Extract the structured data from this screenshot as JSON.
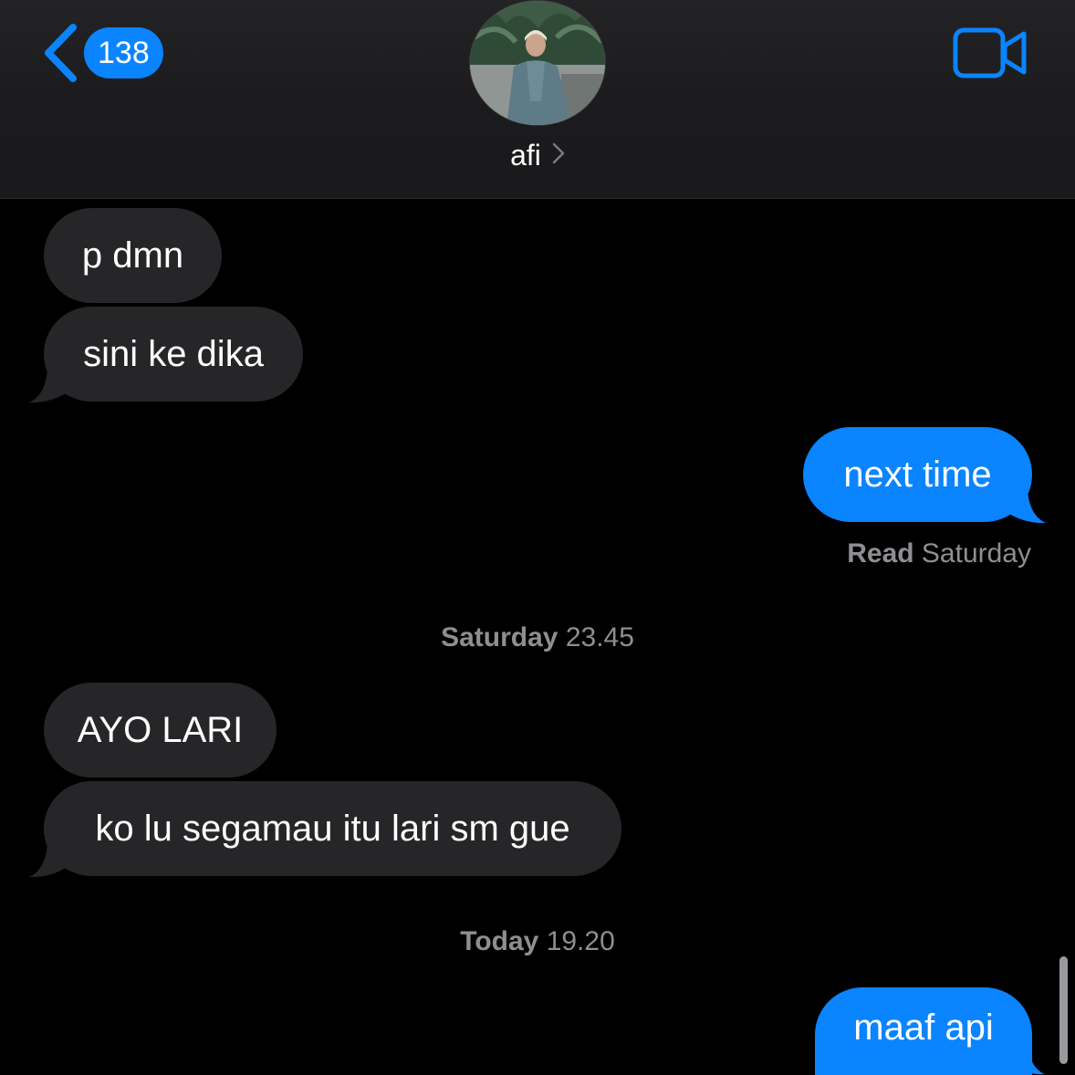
{
  "header": {
    "back_count": "138",
    "contact_name": "afi"
  },
  "messages": [
    {
      "id": "m1",
      "text": "p dmn",
      "direction": "incoming"
    },
    {
      "id": "m2",
      "text": "sini ke dika",
      "direction": "incoming"
    },
    {
      "id": "m3",
      "text": "next time",
      "direction": "outgoing"
    },
    {
      "id": "m4",
      "text": "AYO LARI",
      "direction": "incoming"
    },
    {
      "id": "m5",
      "text": "ko lu segamau itu lari sm gue",
      "direction": "incoming"
    },
    {
      "id": "m6",
      "text": "maaf api",
      "direction": "outgoing"
    }
  ],
  "read_receipt": {
    "label": "Read",
    "day": "Saturday"
  },
  "timestamps": [
    {
      "day": "Saturday",
      "time": "23.45"
    },
    {
      "day": "Today",
      "time": "19.20"
    }
  ],
  "icons": [
    "back-chevron-icon",
    "video-camera-icon",
    "chevron-right-icon"
  ],
  "colors": {
    "accent": "#0a84ff",
    "incoming_bubble": "#262628",
    "background": "#000000"
  }
}
